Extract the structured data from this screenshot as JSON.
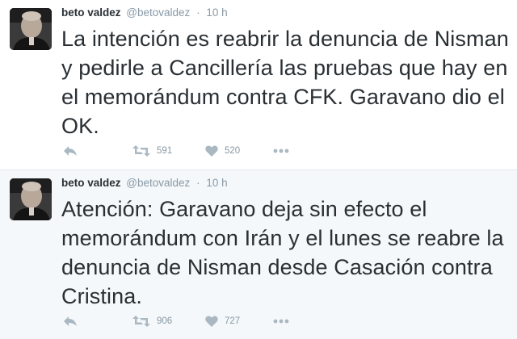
{
  "tweets": [
    {
      "name": "beto valdez",
      "handle": "@betovaldez",
      "separator": "·",
      "time": "10 h",
      "text": "La intención es reabrir la denuncia de Nisman y pedirle a Cancillería las pruebas que hay en el memorándum contra CFK. Garavano dio el OK.",
      "retweets": "591",
      "likes": "520"
    },
    {
      "name": "beto valdez",
      "handle": "@betovaldez",
      "separator": "·",
      "time": "10 h",
      "text": "Atención: Garavano deja sin efecto el memorándum con Irán y el lunes se reabre la denuncia de Nisman desde Casación contra Cristina.",
      "retweets": "906",
      "likes": "727"
    }
  ],
  "icons": {
    "reply": "reply-icon",
    "retweet": "retweet-icon",
    "like": "heart-icon",
    "more": "more-dots-icon"
  },
  "colors": {
    "text": "#292f33",
    "muted": "#8899a6",
    "icon": "#aab8c2",
    "highlight_bg": "#f5f8fa"
  }
}
